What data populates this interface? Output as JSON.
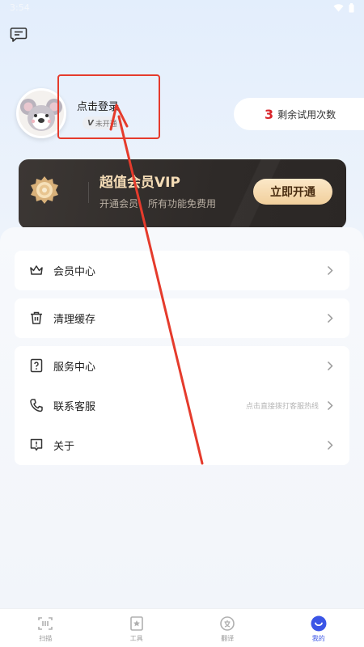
{
  "status_bar": {
    "time": "3:54"
  },
  "profile": {
    "login_label": "点击登录",
    "vip_status_badge": "未开通",
    "vip_status_mark": "V"
  },
  "trial": {
    "count": "3",
    "label": "剩余试用次数"
  },
  "vip_card": {
    "title": "超值会员VIP",
    "subtitle": "开通会员，所有功能免费用",
    "cta": "立即开通"
  },
  "menu": {
    "group1": [
      {
        "label": "会员中心",
        "icon": "crown-icon"
      }
    ],
    "group2": [
      {
        "label": "清理缓存",
        "icon": "trash-icon"
      }
    ],
    "group3": [
      {
        "label": "服务中心",
        "icon": "help-icon"
      },
      {
        "label": "联系客服",
        "icon": "phone-icon",
        "hint": "点击直接拨打客服热线"
      },
      {
        "label": "关于",
        "icon": "info-icon"
      }
    ]
  },
  "bottom_nav": [
    {
      "label": "扫描",
      "icon": "scan-icon",
      "active": false
    },
    {
      "label": "工具",
      "icon": "tools-icon",
      "active": false
    },
    {
      "label": "翻译",
      "icon": "translate-icon",
      "active": false
    },
    {
      "label": "我的",
      "icon": "profile-icon",
      "active": true
    }
  ],
  "colors": {
    "accent": "#3b55e6",
    "annotation_red": "#e53b2c",
    "trial_number": "#d9262c",
    "vip_gold": "#f4dcb6"
  }
}
